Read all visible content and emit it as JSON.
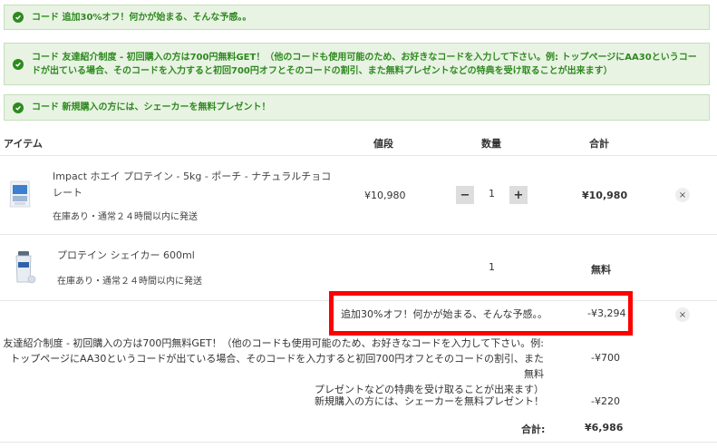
{
  "banners": [
    "コード 追加30%オフ！何かが始まる、そんな予感。。",
    "コード 友達紹介制度 - 初回購入の方は700円無料GET！（他のコードも使用可能のため、お好きなコードを入力して下さい。例: トップページにAA30というコードが出ている場合、そのコードを入力すると初回700円オフとそのコードの割引、また無料プレゼントなどの特典を受け取ることが出来ます）",
    "コード 新規購入の方には、シェーカーを無料プレゼント！"
  ],
  "table_headers": {
    "item": "アイテム",
    "price": "値段",
    "qty": "数量",
    "total": "合計"
  },
  "items": [
    {
      "name_line1": "Impact ホエイ プロテイン - 5kg - ポーチ - ナチュラルチョコ",
      "name_line2": "レート",
      "stock": "在庫あり・通常２４時間以内に発送",
      "price": "¥10,980",
      "qty": "1",
      "minus": "−",
      "plus": "+",
      "total": "¥10,980",
      "remove": "×"
    },
    {
      "name": "プロテイン シェイカー 600ml",
      "stock": "在庫あり・通常２４時間以内に発送",
      "qty": "1",
      "total": "無料"
    }
  ],
  "discounts": [
    {
      "label": "追加30%オフ！何かが始まる、そんな予感。。",
      "value": "-¥3,294",
      "remove": "×"
    },
    {
      "label_line1": "友達紹介制度 - 初回購入の方は700円無料GET！（他のコードも使用可能のため、お好きなコードを入力して下さい。例:",
      "label_line2": "トップページにAA30というコードが出ている場合、そのコードを入力すると初回700円オフとそのコードの割引、また無料",
      "label_line3": "プレゼントなどの特典を受け取ることが出来ます）",
      "value": "-¥700"
    },
    {
      "label": "新規購入の方には、シェーカーを無料プレゼント！",
      "value": "-¥220"
    }
  ],
  "summary": {
    "label": "合計:",
    "value": "¥6,986"
  },
  "colors": {
    "banner_bg": "#e8f3e3",
    "banner_text": "#2e8a1f",
    "highlight": "#ff0000"
  }
}
